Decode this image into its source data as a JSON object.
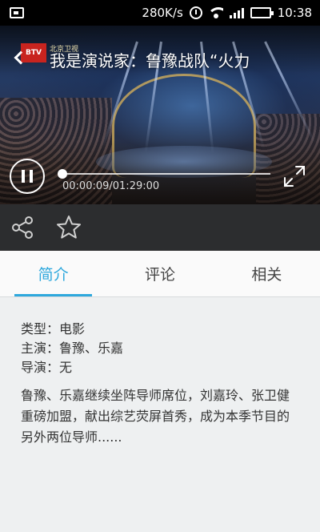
{
  "status_bar": {
    "speed": "280K/s",
    "time": "10:38"
  },
  "video": {
    "channel_logo": "BTV",
    "channel_name": "北京卫视",
    "title": "我是演说家：鲁豫战队“火力",
    "time_display": "00:00:09/01:29:00",
    "progress": 0.0017
  },
  "tabs": [
    {
      "label": "简介",
      "active": true
    },
    {
      "label": "评论",
      "active": false
    },
    {
      "label": "相关",
      "active": false
    }
  ],
  "info": {
    "type": "类型：电影",
    "cast": "主演：鲁豫、乐嘉",
    "director": "导演：无",
    "description": "鲁豫、乐嘉继续坐阵导师席位，刘嘉玲、张卫健重磅加盟，献出综艺荧屏首秀，成为本季节目的另外两位导师......"
  },
  "colors": {
    "accent": "#2ea8dd",
    "action_bar": "#2c2d2f",
    "battery": "#45d05a"
  }
}
